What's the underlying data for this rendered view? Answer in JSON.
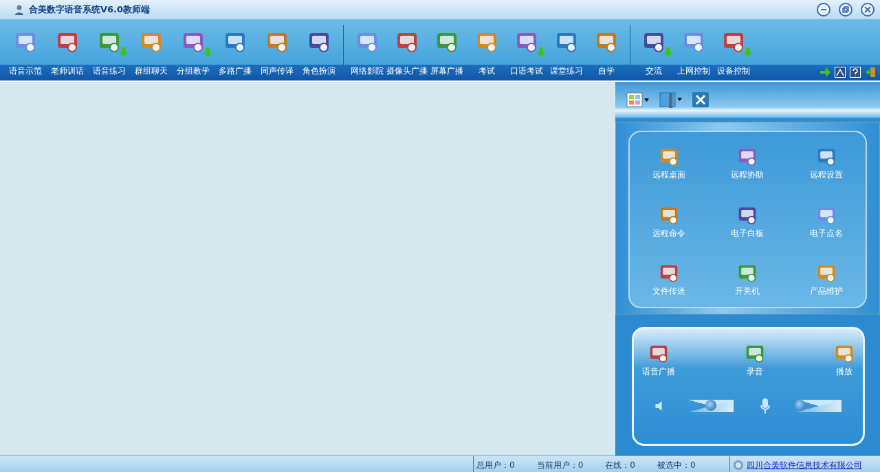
{
  "window": {
    "title": "合美数字语音系统V6.0教师端"
  },
  "toolbar": {
    "groups": [
      [
        {
          "label": "语音示范",
          "has_menu": false
        },
        {
          "label": "老师训话",
          "has_menu": false
        },
        {
          "label": "语音练习",
          "has_menu": true
        },
        {
          "label": "群组聊天",
          "has_menu": false
        },
        {
          "label": "分组教学",
          "has_menu": true
        },
        {
          "label": "多路广播",
          "has_menu": false
        },
        {
          "label": "同声传译",
          "has_menu": false
        },
        {
          "label": "角色扮演",
          "has_menu": false
        }
      ],
      [
        {
          "label": "网络影院",
          "has_menu": false
        },
        {
          "label": "摄像头广播",
          "has_menu": false
        },
        {
          "label": "屏幕广播",
          "has_menu": false
        },
        {
          "label": "考试",
          "has_menu": false
        },
        {
          "label": "口语考试",
          "has_menu": true
        },
        {
          "label": "课堂练习",
          "has_menu": false
        },
        {
          "label": "自学",
          "has_menu": false
        }
      ],
      [
        {
          "label": "交流",
          "has_menu": true
        },
        {
          "label": "上网控制",
          "has_menu": false
        },
        {
          "label": "设备控制",
          "has_menu": true
        }
      ]
    ]
  },
  "remote_panel": {
    "items": [
      {
        "label": "远程桌面"
      },
      {
        "label": "远程协助"
      },
      {
        "label": "远程设置"
      },
      {
        "label": "远程命令"
      },
      {
        "label": "电子白板"
      },
      {
        "label": "电子点名"
      },
      {
        "label": "文件传送"
      },
      {
        "label": "开关机"
      },
      {
        "label": "产品维护"
      }
    ]
  },
  "audio_panel": {
    "buttons": [
      {
        "label": "语音广播"
      },
      {
        "label": "录音"
      },
      {
        "label": "播放"
      }
    ],
    "speaker_volume": {
      "level": 0.5
    },
    "mic_volume": {
      "level": 0.1
    }
  },
  "status_bar": {
    "fields": [
      "总用户：0",
      "当前用户：0",
      "在线：0",
      "被选中：0"
    ],
    "company_link": "四川合美软件信息技术有限公司"
  }
}
